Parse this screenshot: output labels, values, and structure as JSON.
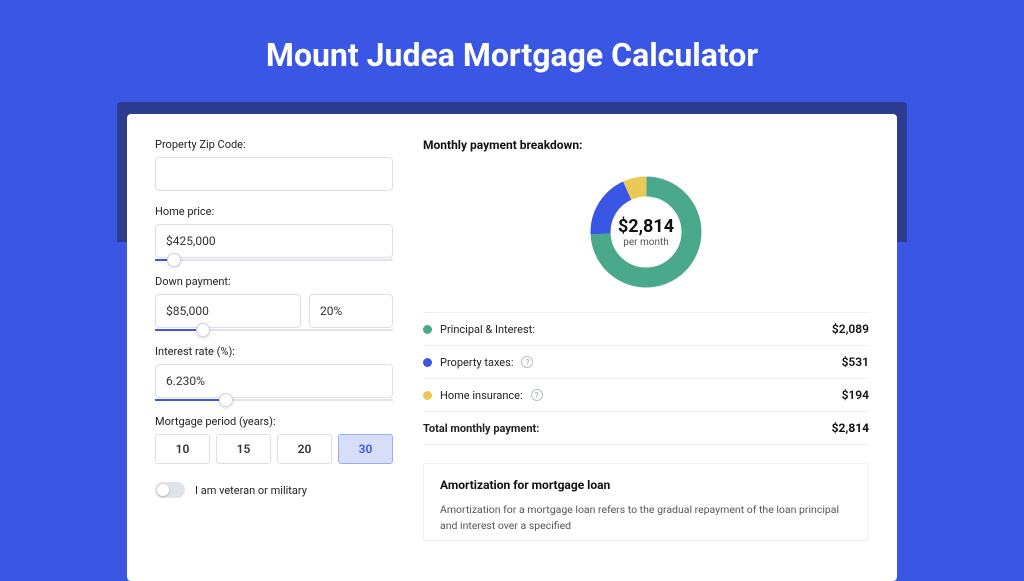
{
  "header": {
    "title": "Mount Judea Mortgage Calculator"
  },
  "form": {
    "zip_label": "Property Zip Code:",
    "zip_value": "",
    "home_price_label": "Home price:",
    "home_price_value": "$425,000",
    "home_price_slider_pct": 8,
    "down_payment_label": "Down payment:",
    "down_payment_value": "$85,000",
    "down_payment_pct": "20%",
    "down_payment_slider_pct": 20,
    "interest_label": "Interest rate (%):",
    "interest_value": "6.230%",
    "interest_slider_pct": 30,
    "period_label": "Mortgage period (years):",
    "periods": [
      {
        "label": "10",
        "active": false
      },
      {
        "label": "15",
        "active": false
      },
      {
        "label": "20",
        "active": false
      },
      {
        "label": "30",
        "active": true
      }
    ],
    "veteran_label": "I am veteran or military"
  },
  "breakdown": {
    "title": "Monthly payment breakdown:",
    "center_amount": "$2,814",
    "center_sub": "per month",
    "items": [
      {
        "label": "Principal & Interest:",
        "value": "$2,089",
        "color": "#4aa98a",
        "help": false
      },
      {
        "label": "Property taxes:",
        "value": "$531",
        "color": "#3a56e4",
        "help": true
      },
      {
        "label": "Home insurance:",
        "value": "$194",
        "color": "#eac957",
        "help": true
      }
    ],
    "total_label": "Total monthly payment:",
    "total_value": "$2,814"
  },
  "chart_data": {
    "type": "pie",
    "title": "Monthly payment breakdown",
    "series": [
      {
        "name": "Principal & Interest",
        "value": 2089,
        "color": "#4aa98a"
      },
      {
        "name": "Property taxes",
        "value": 531,
        "color": "#3a56e4"
      },
      {
        "name": "Home insurance",
        "value": 194,
        "color": "#eac957"
      }
    ],
    "total": 2814
  },
  "amort": {
    "title": "Amortization for mortgage loan",
    "text": "Amortization for a mortgage loan refers to the gradual repayment of the loan principal and interest over a specified"
  }
}
